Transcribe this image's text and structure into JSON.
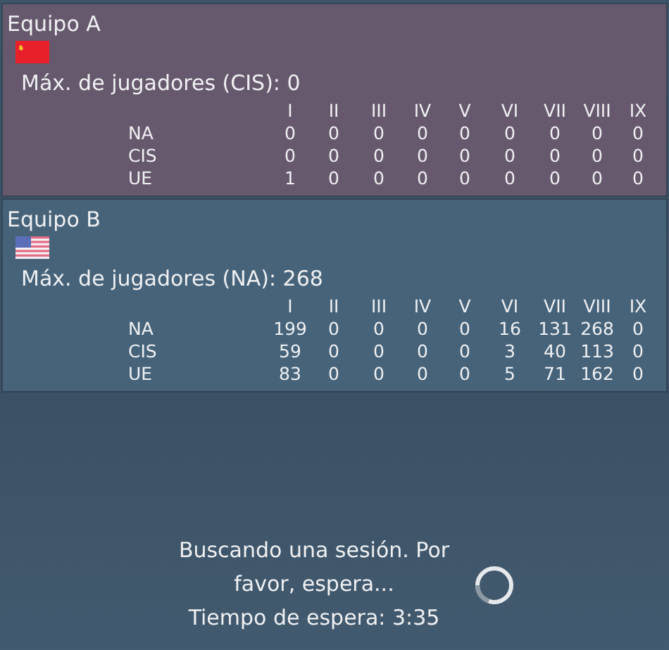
{
  "teams": [
    {
      "title": "Equipo A",
      "max_players": "Máx. de jugadores (CIS): 0",
      "columns": [
        "I",
        "II",
        "III",
        "IV",
        "V",
        "VI",
        "VII",
        "VIII",
        "IX"
      ],
      "rows": [
        {
          "region": "NA",
          "values": [
            "0",
            "0",
            "0",
            "0",
            "0",
            "0",
            "0",
            "0",
            "0"
          ]
        },
        {
          "region": "CIS",
          "values": [
            "0",
            "0",
            "0",
            "0",
            "0",
            "0",
            "0",
            "0",
            "0"
          ]
        },
        {
          "region": "UE",
          "values": [
            "1",
            "0",
            "0",
            "0",
            "0",
            "0",
            "0",
            "0",
            "0"
          ]
        }
      ]
    },
    {
      "title": "Equipo B",
      "max_players": "Máx. de jugadores (NA): 268",
      "columns": [
        "I",
        "II",
        "III",
        "IV",
        "V",
        "VI",
        "VII",
        "VIII",
        "IX"
      ],
      "rows": [
        {
          "region": "NA",
          "values": [
            "199",
            "0",
            "0",
            "0",
            "0",
            "16",
            "131",
            "268",
            "0"
          ]
        },
        {
          "region": "CIS",
          "values": [
            "59",
            "0",
            "0",
            "0",
            "0",
            "3",
            "40",
            "113",
            "0"
          ]
        },
        {
          "region": "UE",
          "values": [
            "83",
            "0",
            "0",
            "0",
            "0",
            "5",
            "71",
            "162",
            "0"
          ]
        }
      ]
    }
  ],
  "status": {
    "message": "Buscando una sesión. Por favor, espera...",
    "wait_time": "Tiempo de espera: 3:35"
  }
}
